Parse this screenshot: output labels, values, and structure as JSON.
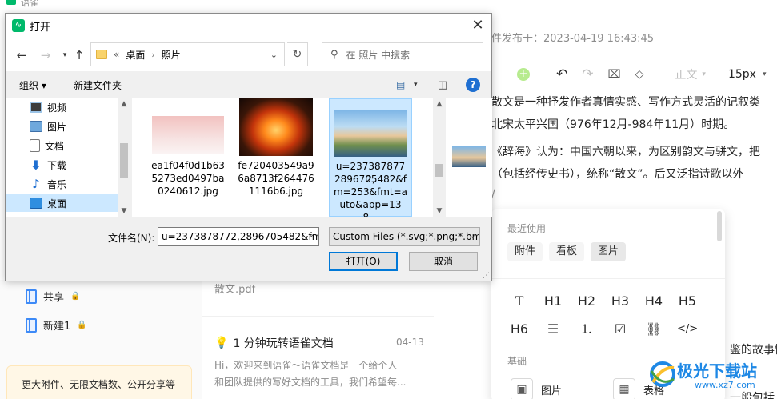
{
  "app": {
    "title": "语雀",
    "publish_time": "件发布于：2023-04-19 16:43:45"
  },
  "left_panel": {
    "items": [
      {
        "label": "共享"
      },
      {
        "label": "新建1"
      }
    ],
    "promo": "更大附件、无限文档数、公开分享等"
  },
  "mid_panel": {
    "pdf_name": "散文.pdf",
    "doc_title": "1 分钟玩转语雀文档",
    "doc_date": "04-13",
    "doc_snippet_1": "Hi，欢迎来到语雀～语雀文档是一个给个人",
    "doc_snippet_2": "和团队提供的写好文档的工具，我们希望每..."
  },
  "editor": {
    "style_label": "正文",
    "font_size": "15px",
    "lines": [
      "散文是一种抒发作者真情实感、写作方式灵活的记叙类",
      "北宋太平兴国（976年12月-984年11月）时期。",
      "《辞海》认为：中国六朝以来，为区别韵文与骈文，把",
      "（包括经传史书），统称“散文”。后又泛指诗歌以外",
      "鉴的故事情",
      "一般包括"
    ]
  },
  "insert_popup": {
    "recent_label": "最近使用",
    "recent": [
      "附件",
      "看板",
      "图片"
    ],
    "recent_active": "图片",
    "formats_row1": [
      "T",
      "H1",
      "H2",
      "H3",
      "H4",
      "H5"
    ],
    "formats_row2": [
      "H6",
      "bullet-list-icon",
      "ordered-list-icon",
      "checkbox-icon",
      "link-icon",
      "code-icon"
    ],
    "basic_label": "基础",
    "basic": [
      {
        "label": "图片",
        "icon": "image-icon"
      },
      {
        "label": "表格",
        "icon": "table-icon"
      }
    ]
  },
  "watermark": {
    "brand": "极光下载站",
    "url": "www.xz7.com"
  },
  "dialog": {
    "title": "打开",
    "address": {
      "prefix": "«",
      "crumbs": [
        "桌面",
        "照片"
      ]
    },
    "search_placeholder": "在 照片 中搜索",
    "organize": "组织 ▾",
    "new_folder": "新建文件夹",
    "nav_items": [
      {
        "label": "视频",
        "icon": "video-icon"
      },
      {
        "label": "图片",
        "icon": "pictures-icon"
      },
      {
        "label": "文档",
        "icon": "documents-icon"
      },
      {
        "label": "下载",
        "icon": "download-icon"
      },
      {
        "label": "音乐",
        "icon": "music-icon"
      },
      {
        "label": "桌面",
        "icon": "desktop-icon"
      }
    ],
    "nav_selected": "桌面",
    "files": [
      {
        "name": "ea1f04f0d1b635273ed0497be0240612.jpg",
        "lines": [
          "ea1f04f0d1b63",
          "5273ed0497ba",
          "0240612.jpg"
        ]
      },
      {
        "name": "fe720403549a96a8713f2644761116b6.jpg",
        "lines": [
          "fe720403549a9",
          "6a8713f264476",
          "1116b6.jpg"
        ]
      },
      {
        "name": "u=2373878772,2896705482&fm=253&fmt=auto&app=138...",
        "lines": [
          "u=2373878772,",
          "2896705482&f",
          "m=253&fmt=a",
          "uto&app=138..."
        ]
      }
    ],
    "selected_file_index": 2,
    "filename_label": "文件名(N):",
    "filename_value": "u=2373878772,2896705482&fm=253&fmt=auto&app=138",
    "filter_value": "Custom Files (*.svg;*.png;*.bmp",
    "open_button": "打开(O)",
    "cancel_button": "取消"
  }
}
